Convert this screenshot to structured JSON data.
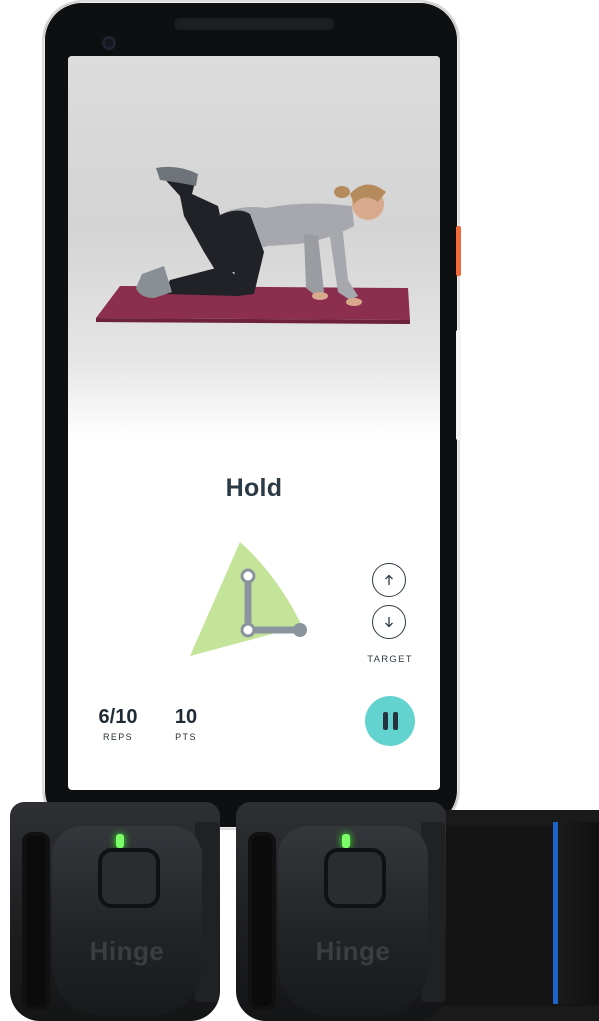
{
  "screen": {
    "exercise_title": "Hold",
    "target_label": "TARGET",
    "stats": {
      "reps_value": "6/10",
      "reps_unit": "REPS",
      "points_value": "10",
      "points_unit": "PTS"
    }
  },
  "sensors": {
    "brand": "Hinge",
    "led_color": "#7dff6a"
  },
  "colors": {
    "accent_teal": "#63d3cf",
    "gauge_green": "#c4e49a",
    "joint_gray": "#8a949c",
    "text_dark": "#2c3a45",
    "phone_side_button": "#ef6b3c",
    "strap_trim": "#1e63c9"
  }
}
